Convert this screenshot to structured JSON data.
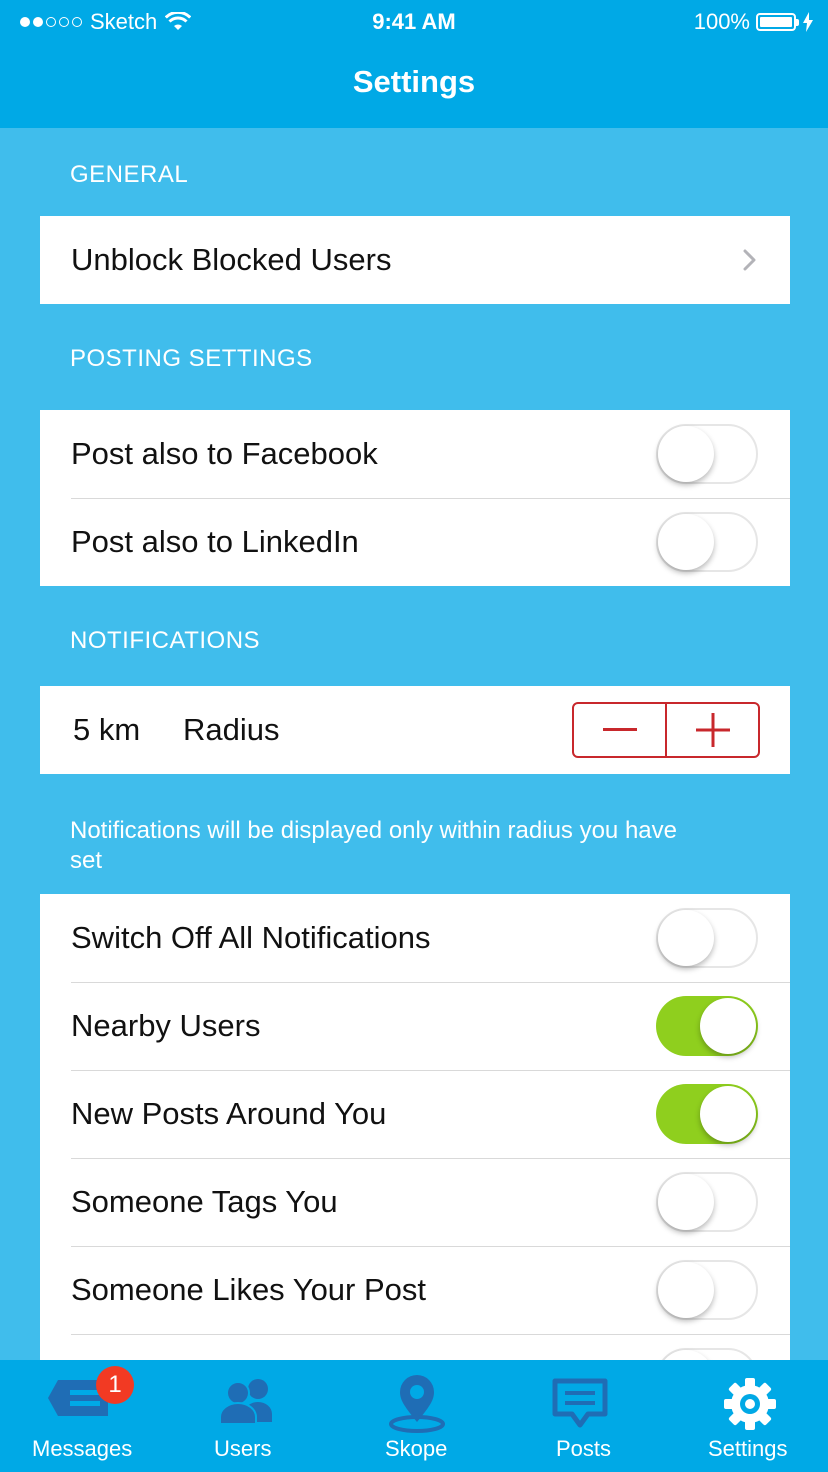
{
  "status_bar": {
    "carrier": "Sketch",
    "time": "9:41 AM",
    "battery": "100%"
  },
  "nav": {
    "title": "Settings"
  },
  "general": {
    "header": "GENERAL",
    "items": [
      {
        "label": "Unblock Blocked Users"
      }
    ]
  },
  "posting": {
    "header": "POSTING SETTINGS",
    "items": [
      {
        "label": "Post also to Facebook",
        "enabled": false
      },
      {
        "label": "Post also to LinkedIn",
        "enabled": false
      }
    ]
  },
  "notifications": {
    "header": "NOTIFICATIONS",
    "radius": {
      "value": "5 km",
      "label": "Radius"
    },
    "note": "Notifications will be displayed only within radius you have set",
    "items": [
      {
        "label": "Switch Off All Notifications",
        "enabled": false
      },
      {
        "label": "Nearby Users",
        "enabled": true
      },
      {
        "label": "New Posts Around You",
        "enabled": true
      },
      {
        "label": "Someone Tags You",
        "enabled": false
      },
      {
        "label": "Someone Likes Your Post",
        "enabled": false
      }
    ]
  },
  "tabbar": {
    "tabs": [
      {
        "label": "Messages",
        "icon": "messages-icon",
        "badge": "1"
      },
      {
        "label": "Users",
        "icon": "users-icon"
      },
      {
        "label": "Skope",
        "icon": "location-pin-icon"
      },
      {
        "label": "Posts",
        "icon": "posts-icon"
      },
      {
        "label": "Settings",
        "icon": "gear-icon",
        "active": true
      }
    ]
  },
  "colors": {
    "nav": "#00a9e6",
    "background": "#40bdec",
    "toggle_on": "#8fcf1e",
    "stepper": "#c8282c",
    "tab_inactive": "#1f6db5",
    "badge": "#f23a23"
  }
}
